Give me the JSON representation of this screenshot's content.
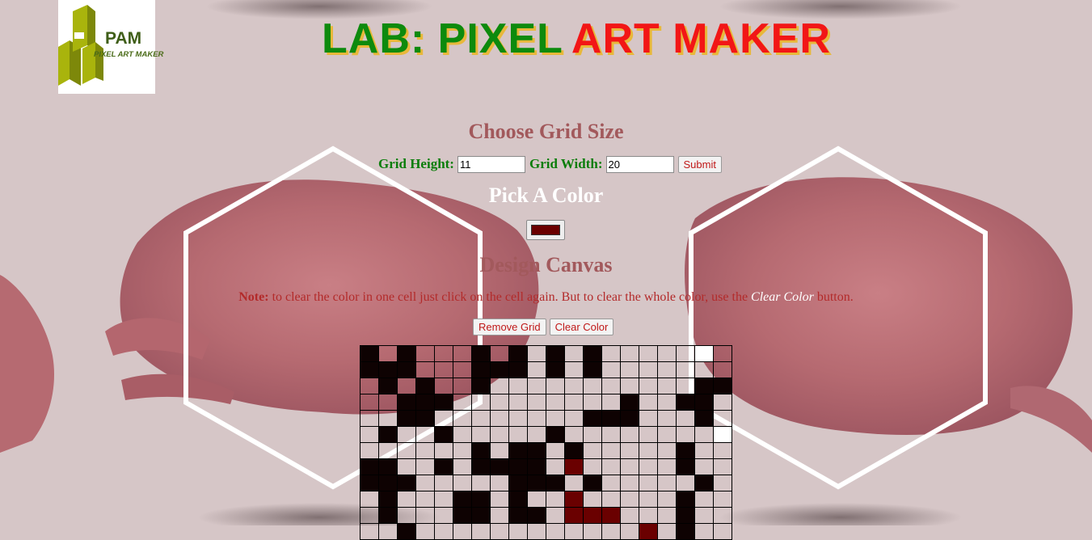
{
  "logo": {
    "short": "PAM",
    "tagline": "PIXEL ART MAKER"
  },
  "title": {
    "part1": "LAB: PIXEL",
    "part2": "ART MAKER"
  },
  "grid_size": {
    "heading": "Choose Grid Size",
    "height_label": "Grid Height:",
    "height_value": "11",
    "width_label": "Grid Width:",
    "width_value": "20",
    "submit_label": "Submit"
  },
  "color": {
    "heading": "Pick A Color",
    "selected": "#6a0000"
  },
  "canvas": {
    "heading": "Design Canvas",
    "note_label": "Note:",
    "note_text": " to clear the color in one cell just click on the cell again. But to clear the whole color, use the ",
    "note_emphasis": "Clear Color",
    "note_end": " button.",
    "remove_grid_label": "Remove Grid",
    "clear_color_label": "Clear Color",
    "palette": {
      ".": "transparent",
      "k": "#0e0202",
      "r": "#6a0000",
      "w": "#ffffff"
    },
    "rows": [
      "k.k...k.k.k.k.....w.",
      "kkk...kkk.k.k.......",
      ".k.k..k...........kk",
      "..kkk.........k..kk.",
      "..kk........kkk...k.",
      ".k..k.....k........w",
      "......k.kk.k.....k..",
      "kk..k.kkkk.r.....k..",
      "kkk.....kkk.k.....k.",
      ".k...kk.k..r.....k..",
      ".k...kk.kk.rrr...k..",
      "..k............r.k.."
    ]
  }
}
